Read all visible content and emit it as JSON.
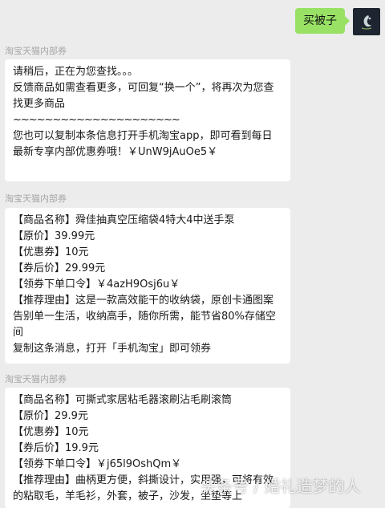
{
  "outgoing": {
    "text": "买被子"
  },
  "messages": [
    {
      "sender": "淘宝天猫内部券",
      "lines": [
        "请稍后，正在为您查找。。。",
        "反馈商品如需查看更多，可回复“换一个”，将再次为您查找更多商品",
        "~~~~~~~~~~~~~~~~~~~~~",
        "您也可以复制本条信息打开手机淘宝app，即可看到每日最新专享内部优惠券哦！￥UnW9jAuOe5￥"
      ]
    },
    {
      "sender": "淘宝天猫内部券",
      "lines": [
        "【商品名称】舜佳抽真空压缩袋4特大4中送手泵",
        "【原价】39.99元",
        "【优惠券】10元",
        "【券后价】29.99元",
        "【领券下单口令】￥4azH9Osj6u￥",
        "【推荐理由】这是一款高效能干的收纳袋，原创卡通图案告别单一生活，收纳高手，随你所需，能节省80%存储空间",
        "复制这条消息，打开「手机淘宝」即可领券"
      ]
    },
    {
      "sender": "淘宝天猫内部券",
      "lines": [
        "【商品名称】可撕式家居粘毛器滚刷沾毛刷滚筒",
        "【原价】29.9元",
        "【优惠券】10元",
        "【券后价】19.9元",
        "【领券下单口令】￥j65l9OshQm￥",
        "【推荐理由】曲柄更方便，斜撕设计，实用强，可将有效的粘取毛，羊毛衫，外套，被子，沙发，坐垫等上"
      ]
    }
  ],
  "watermark": {
    "text": "头条号 / 婚礼造梦的人"
  },
  "colors": {
    "outgoing_bubble": "#98e165",
    "background": "#ececec",
    "bubble": "#ffffff",
    "sender": "#a6a6a6"
  }
}
